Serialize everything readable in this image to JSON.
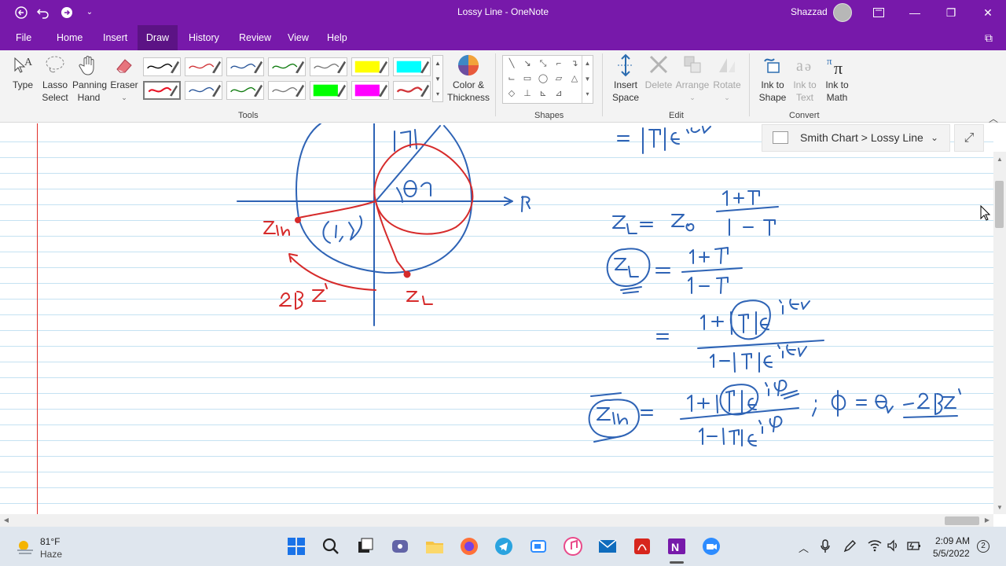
{
  "window": {
    "title": "Lossy Line  - OneNote",
    "user_name": "Shazzad",
    "back_icon": "back-arrow-icon",
    "undo_icon": "undo-icon",
    "redo_icon": "redo-icon",
    "customize_icon": "chevron-down-icon"
  },
  "menu": {
    "tabs": [
      {
        "label": "File"
      },
      {
        "label": "Home"
      },
      {
        "label": "Insert"
      },
      {
        "label": "Draw",
        "active": true
      },
      {
        "label": "History"
      },
      {
        "label": "Review"
      },
      {
        "label": "View"
      },
      {
        "label": "Help"
      }
    ]
  },
  "ribbon": {
    "type_label": "Type",
    "lasso_label": "Lasso\nSelect",
    "lasso_l1": "Lasso",
    "lasso_l2": "Select",
    "panning_l1": "Panning",
    "panning_l2": "Hand",
    "eraser_label": "Eraser",
    "color_l1": "Color &",
    "color_l2": "Thickness",
    "tools_group": "Tools",
    "shapes_group": "Shapes",
    "insert_space_l1": "Insert",
    "insert_space_l2": "Space",
    "delete_label": "Delete",
    "arrange_label": "Arrange",
    "rotate_label": "Rotate",
    "edit_group": "Edit",
    "ink_shape_l1": "Ink to",
    "ink_shape_l2": "Shape",
    "ink_text_l1": "Ink to",
    "ink_text_l2": "Text",
    "ink_math_l1": "Ink to",
    "ink_math_l2": "Math",
    "convert_group": "Convert",
    "pens": [
      {
        "color": "#000000"
      },
      {
        "color": "#d13438"
      },
      {
        "color": "#2b579a"
      },
      {
        "color": "#107c10"
      },
      {
        "color": "#7a7a7a"
      },
      {
        "color": "#ffff00"
      },
      {
        "color": "#00ffff"
      },
      {
        "color": "#e81123"
      },
      {
        "color": "#2b579a"
      },
      {
        "color": "#107c10"
      },
      {
        "color": "#7a7a7a"
      },
      {
        "color": "#00ff00"
      },
      {
        "color": "#ff00ff"
      },
      {
        "color": "#d13438"
      }
    ]
  },
  "page": {
    "breadcrumb": "Smith Chart > Lossy Line",
    "ink_colors": {
      "blue": "#2e63b5",
      "red": "#d62b2b"
    }
  },
  "taskbar": {
    "temperature": "81°F",
    "weather": "Haze",
    "time": "2:09 AM",
    "date": "5/5/2022",
    "notifications": "2"
  }
}
